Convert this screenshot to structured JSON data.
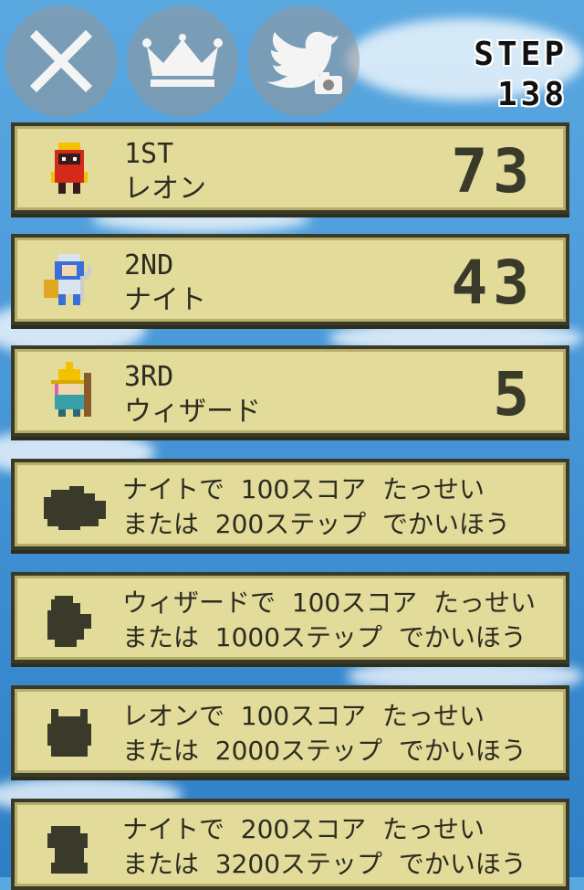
{
  "header": {
    "step_label": "STEP",
    "step_value": "138"
  },
  "buttons": {
    "close_icon": "close-icon",
    "ranking_icon": "crown-icon",
    "share_icon": "twitter-camera-icon"
  },
  "rankings": [
    {
      "rank": "1ST",
      "name": "レオン",
      "score": "73"
    },
    {
      "rank": "2ND",
      "name": "ナイト",
      "score": "43"
    },
    {
      "rank": "3RD",
      "name": "ウィザード",
      "score": "5"
    }
  ],
  "unlocks": [
    {
      "line1": "ナイトで  100スコア  たっせい",
      "line2": "または  200ステップ  でかいほう"
    },
    {
      "line1": "ウィザードで  100スコア  たっせい",
      "line2": "または  1000ステップ  でかいほう"
    },
    {
      "line1": "レオンで  100スコア  たっせい",
      "line2": "または  2000ステップ  でかいほう"
    },
    {
      "line1": "ナイトで  200スコア  たっせい",
      "line2": "または  3200ステップ  でかいほう"
    }
  ],
  "colors": {
    "panel": "#e3db9a",
    "panel_border": "#3a3a28",
    "sky": "#4f9edb"
  }
}
